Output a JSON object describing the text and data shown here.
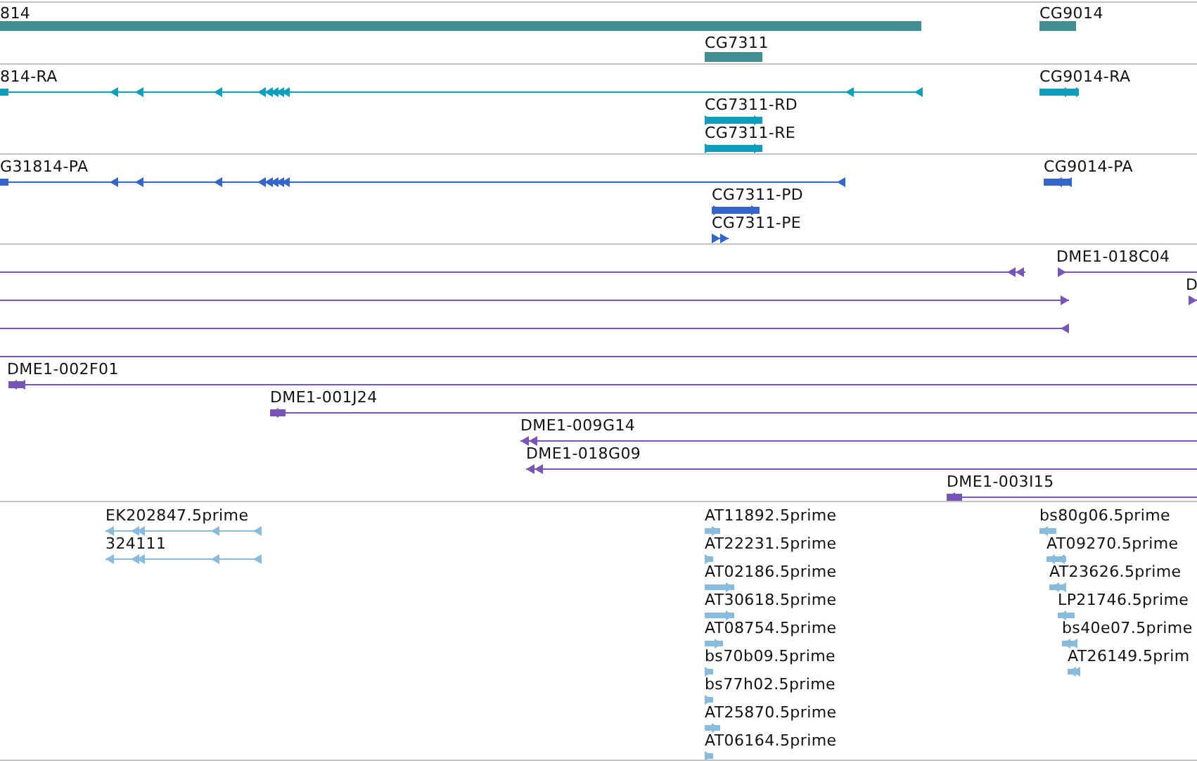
{
  "tracks": [
    {
      "kind": "gene",
      "color": "#418f90",
      "features": [
        {
          "label": "814",
          "kind": "bar"
        },
        {
          "label": "CG7311",
          "kind": "bar"
        },
        {
          "label": "CG9014",
          "kind": "bar"
        }
      ]
    },
    {
      "kind": "transcript",
      "color": "#0e9fbf",
      "features": [
        {
          "label": "814-RA",
          "kind": "line"
        },
        {
          "label": "CG9014-RA",
          "kind": "bar"
        },
        {
          "label": "CG7311-RD",
          "kind": "bar"
        },
        {
          "label": "CG7311-RE",
          "kind": "bar"
        }
      ]
    },
    {
      "kind": "protein",
      "color": "#3366cc",
      "features": [
        {
          "label": "G31814-PA",
          "kind": "line"
        },
        {
          "label": "CG9014-PA",
          "kind": "bar"
        },
        {
          "label": "CG7311-PD",
          "kind": "bar"
        },
        {
          "label": "CG7311-PE",
          "kind": "line"
        }
      ]
    },
    {
      "kind": "clone",
      "color": "#7755bb",
      "features": [
        {
          "kind": "line"
        },
        {
          "label": "DME1-018C04",
          "kind": "line"
        },
        {
          "kind": "line"
        },
        {
          "label": "D",
          "kind": "line"
        },
        {
          "kind": "line"
        },
        {
          "kind": "line"
        },
        {
          "label": "DME1-002F01",
          "kind": "line"
        },
        {
          "label": "DME1-001J24",
          "kind": "line"
        },
        {
          "label": "DME1-009G14",
          "kind": "line"
        },
        {
          "label": "DME1-018G09",
          "kind": "line"
        },
        {
          "label": "DME1-003I15",
          "kind": "line"
        }
      ]
    },
    {
      "kind": "read",
      "color": "#88bbdd",
      "features": [
        {
          "label": "EK202847.5prime",
          "kind": "line"
        },
        {
          "label": "324111",
          "kind": "line"
        },
        {
          "label": "AT11892.5prime",
          "kind": "bar"
        },
        {
          "label": "AT22231.5prime",
          "kind": "bar"
        },
        {
          "label": "AT02186.5prime",
          "kind": "bar"
        },
        {
          "label": "AT30618.5prime",
          "kind": "bar"
        },
        {
          "label": "AT08754.5prime",
          "kind": "bar"
        },
        {
          "label": "bs70b09.5prime",
          "kind": "bar"
        },
        {
          "label": "bs77h02.5prime",
          "kind": "bar"
        },
        {
          "label": "AT25870.5prime",
          "kind": "bar"
        },
        {
          "label": "AT06164.5prime",
          "kind": "bar"
        },
        {
          "label": "bs80g06.5prime",
          "kind": "bar"
        },
        {
          "label": "AT09270.5prime",
          "kind": "bar"
        },
        {
          "label": "AT23626.5prime",
          "kind": "bar"
        },
        {
          "label": "LP21746.5prime",
          "kind": "bar"
        },
        {
          "label": "bs40e07.5prime",
          "kind": "bar"
        },
        {
          "label": "AT26149.5prim",
          "kind": "bar"
        }
      ]
    }
  ]
}
